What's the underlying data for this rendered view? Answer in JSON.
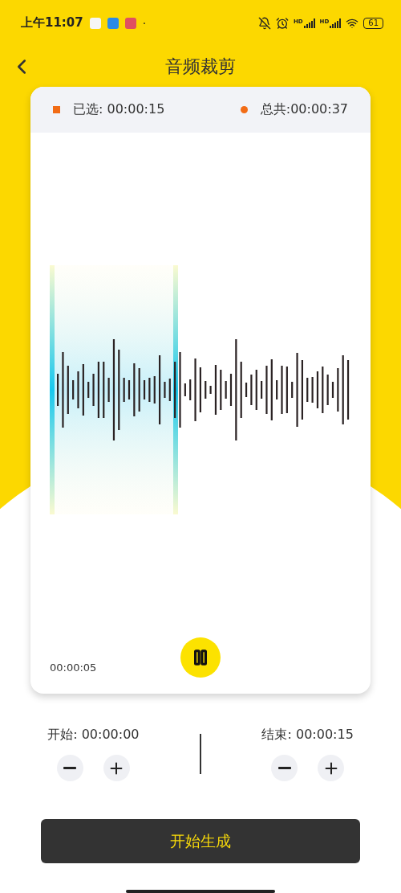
{
  "status_bar": {
    "time": "上午11:07",
    "dot": "·",
    "signal_labels": [
      "HD",
      "HD"
    ],
    "battery": "61"
  },
  "header": {
    "title": "音频裁剪"
  },
  "card": {
    "selected_label": "已选: 00:00:15",
    "total_label": "总共:00:00:37",
    "playhead_time": "00:00:05",
    "playing": true
  },
  "range": [
    {
      "label": "开始: 00:00:00"
    },
    {
      "label": "结束: 00:00:15"
    }
  ],
  "generate_button": "开始生成"
}
